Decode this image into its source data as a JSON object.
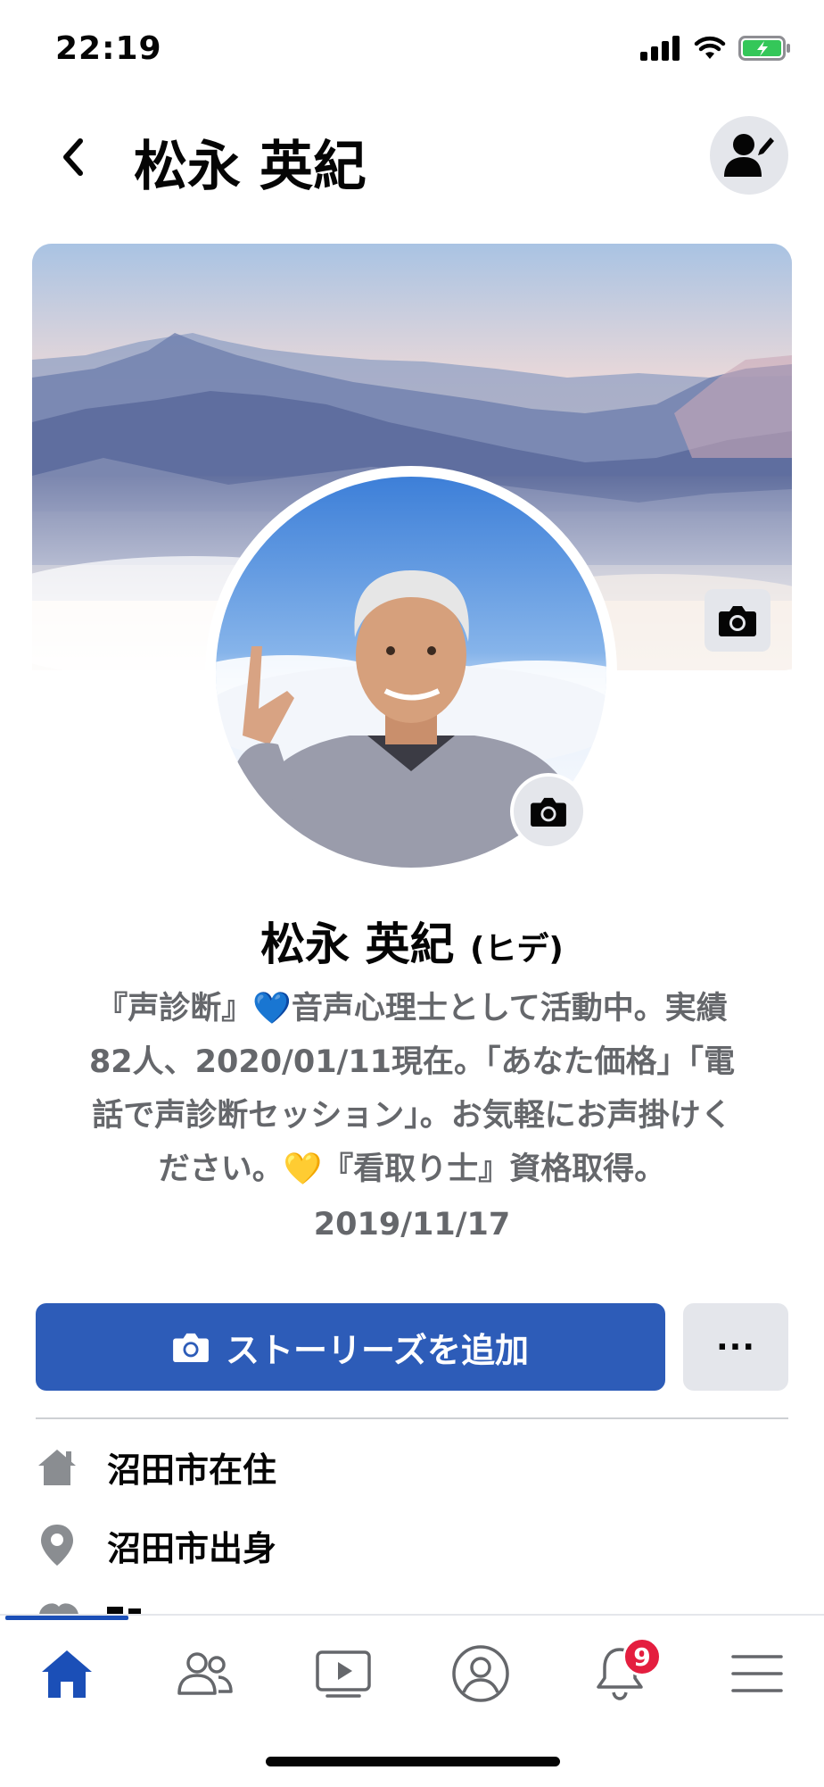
{
  "status": {
    "time": "22:19"
  },
  "header": {
    "title": "松永 英紀",
    "back_icon": "chevron-left-icon",
    "edit_icon": "edit-profile-icon"
  },
  "profile": {
    "name": "松永 英紀",
    "alternate_name": "(ヒデ)",
    "bio_lines": [
      "『声診断』💙音声心理士として活動中。実績",
      "82人、2020/01/11現在。「あなた価格」「電",
      "話で声診断セッション」。お気軽にお声掛けく",
      "ださい。💛『看取り士』資格取得。"
    ],
    "bio_date": "2019/11/17"
  },
  "actions": {
    "add_story_label": "ストーリーズを追加",
    "more_label": "···"
  },
  "info": {
    "lives_in": "沼田市在住",
    "from": "沼田市出身"
  },
  "tabs": [
    {
      "name": "home",
      "icon": "home-icon"
    },
    {
      "name": "friends",
      "icon": "friends-icon"
    },
    {
      "name": "watch",
      "icon": "video-icon"
    },
    {
      "name": "profile",
      "icon": "profile-icon"
    },
    {
      "name": "notifications",
      "icon": "bell-icon",
      "badge": "9"
    },
    {
      "name": "menu",
      "icon": "menu-icon"
    }
  ],
  "colors": {
    "accent": "#2d5cb8",
    "badge": "#e41e3f",
    "battery": "#34c759"
  }
}
